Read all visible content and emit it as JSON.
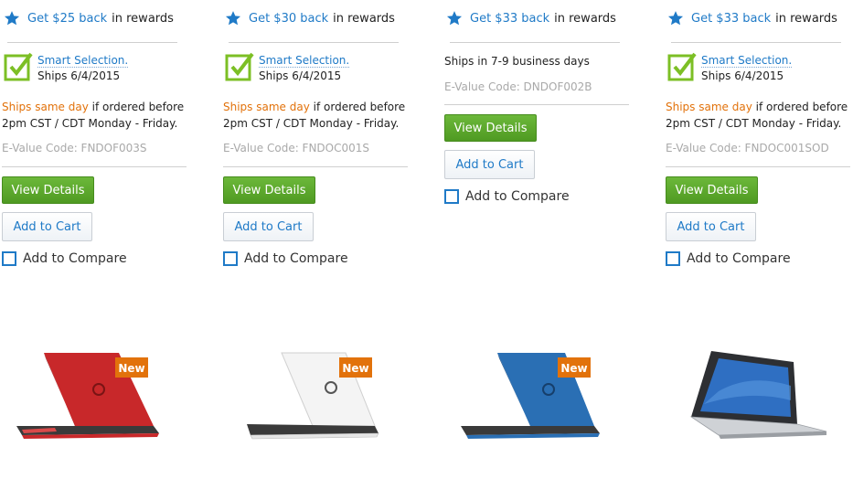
{
  "products": [
    {
      "rewards_link": "Get $25 back",
      "rewards_rest": "in rewards",
      "smart_title": "Smart Selection.",
      "ships_date": "Ships 6/4/2015",
      "ship_same_day": "Ships same day",
      "ship_line1_rest": "if ordered before",
      "ship_line2": "2pm CST / CDT Monday - Friday.",
      "evalue": "E-Value Code: FNDOF003S",
      "view_details": "View Details",
      "add_to_cart": "Add to Cart",
      "add_to_compare": "Add to Compare",
      "badge": "New",
      "color": "#c8282a"
    },
    {
      "rewards_link": "Get $30 back",
      "rewards_rest": "in rewards",
      "smart_title": "Smart Selection.",
      "ships_date": "Ships 6/4/2015",
      "ship_same_day": "Ships same day",
      "ship_line1_rest": "if ordered before",
      "ship_line2": "2pm CST / CDT Monday - Friday.",
      "evalue": "E-Value Code: FNDOC001S",
      "view_details": "View Details",
      "add_to_cart": "Add to Cart",
      "add_to_compare": "Add to Compare",
      "badge": "New",
      "color": "#f2f2f2"
    },
    {
      "rewards_link": "Get $33 back",
      "rewards_rest": "in rewards",
      "ships_business": "Ships in 7-9 business days",
      "evalue": "E-Value Code: DNDOF002B",
      "view_details": "View Details",
      "add_to_cart": "Add to Cart",
      "add_to_compare": "Add to Compare",
      "badge": "New",
      "color": "#2a6fb4"
    },
    {
      "rewards_link": "Get $33 back",
      "rewards_rest": "in rewards",
      "smart_title": "Smart Selection.",
      "ships_date": "Ships 6/4/2015",
      "ship_same_day": "Ships same day",
      "ship_line1_rest": "if ordered before",
      "ship_line2": "2pm CST / CDT Monday - Friday.",
      "evalue": "E-Value Code: FNDOC001SOD",
      "view_details": "View Details",
      "add_to_cart": "Add to Cart",
      "add_to_compare": "Add to Compare",
      "color": "#2d2f33"
    }
  ],
  "colors": {
    "link": "#1f7ac7",
    "orange": "#e2720b",
    "green": "#5aa82a",
    "check": "#7cbf25",
    "badge": "#e2720b"
  }
}
